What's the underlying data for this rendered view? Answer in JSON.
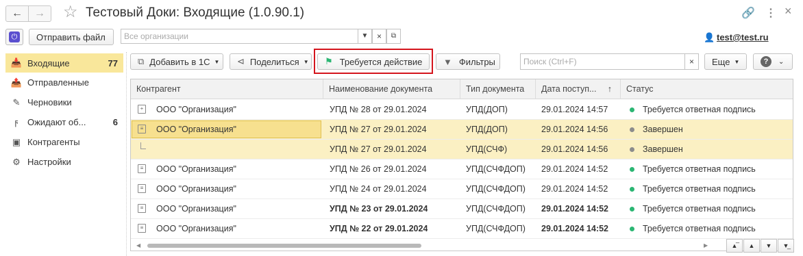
{
  "window": {
    "title": "Тестовый Доки: Входящие (1.0.90.1)"
  },
  "toolbar": {
    "send_file_label": "Отправить файл",
    "org_placeholder": "Все организации",
    "user": "test@test.ru"
  },
  "sidebar": {
    "items": [
      {
        "label": "Входящие",
        "count": "77",
        "icon": "inbox-icon"
      },
      {
        "label": "Отправленные",
        "count": "",
        "icon": "outbox-icon"
      },
      {
        "label": "Черновики",
        "count": "",
        "icon": "pencil-icon"
      },
      {
        "label": "Ожидают об...",
        "count": "6",
        "icon": "lightning-icon"
      },
      {
        "label": "Контрагенты",
        "count": "",
        "icon": "contacts-icon"
      },
      {
        "label": "Настройки",
        "count": "",
        "icon": "gear-icon"
      }
    ]
  },
  "commands": {
    "add_1c": "Добавить в 1С",
    "share": "Поделиться",
    "action_required": "Требуется действие",
    "filters": "Фильтры",
    "search_placeholder": "Поиск (Ctrl+F)",
    "more": "Еще"
  },
  "table": {
    "columns": [
      "Контрагент",
      "Наименование документа",
      "Тип документа",
      "Дата поступ...",
      "Статус"
    ],
    "rows": [
      {
        "counterparty": "ООО \"Организация\"",
        "doc": "УПД № 28 от 29.01.2024",
        "type": "УПД(ДОП)",
        "date": "29.01.2024 14:57",
        "status": "Требуется ответная подпись",
        "status_color": "#2bb673",
        "bold": false
      },
      {
        "counterparty": "ООО \"Организация\"",
        "doc": "УПД № 27 от 29.01.2024",
        "type": "УПД(ДОП)",
        "date": "29.01.2024 14:56",
        "status": "Завершен",
        "status_color": "#8c8c8c",
        "bold": false
      },
      {
        "counterparty": "",
        "doc": "УПД № 27 от 29.01.2024",
        "type": "УПД(СЧФ)",
        "date": "29.01.2024 14:56",
        "status": "Завершен",
        "status_color": "#8c8c8c",
        "bold": false
      },
      {
        "counterparty": "ООО \"Организация\"",
        "doc": "УПД № 26 от 29.01.2024",
        "type": "УПД(СЧФДОП)",
        "date": "29.01.2024 14:52",
        "status": "Требуется ответная подпись",
        "status_color": "#2bb673",
        "bold": false
      },
      {
        "counterparty": "ООО \"Организация\"",
        "doc": "УПД № 24 от 29.01.2024",
        "type": "УПД(СЧФДОП)",
        "date": "29.01.2024 14:52",
        "status": "Требуется ответная подпись",
        "status_color": "#2bb673",
        "bold": false
      },
      {
        "counterparty": "ООО \"Организация\"",
        "doc": "УПД № 23 от 29.01.2024",
        "type": "УПД(СЧФДОП)",
        "date": "29.01.2024 14:52",
        "status": "Требуется ответная подпись",
        "status_color": "#2bb673",
        "bold": true
      },
      {
        "counterparty": "ООО \"Организация\"",
        "doc": "УПД № 22 от 29.01.2024",
        "type": "УПД(СЧФДОП)",
        "date": "29.01.2024 14:52",
        "status": "Требуется ответная подпись",
        "status_color": "#2bb673",
        "bold": true
      }
    ]
  }
}
